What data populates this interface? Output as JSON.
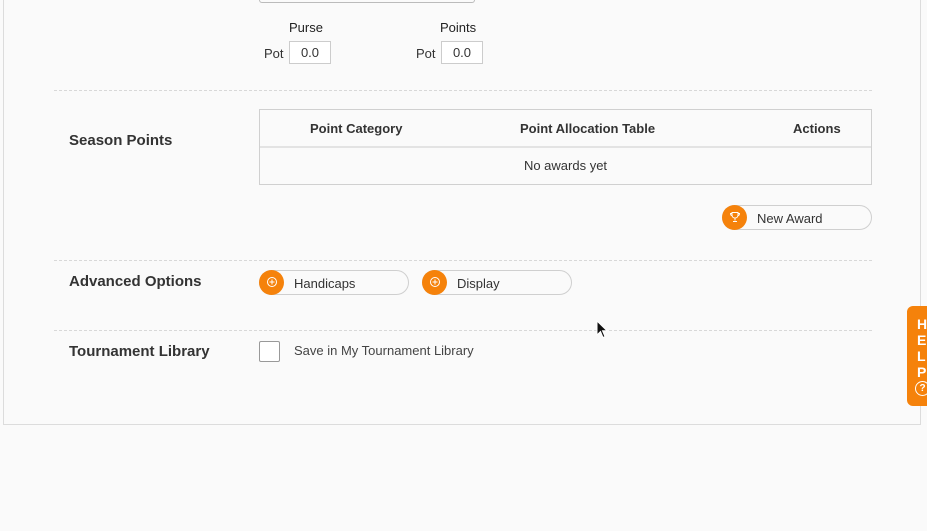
{
  "pots": {
    "purse": {
      "heading": "Purse",
      "label": "Pot",
      "value": "0.0"
    },
    "points": {
      "heading": "Points",
      "label": "Pot",
      "value": "0.0"
    }
  },
  "season_points": {
    "label": "Season Points",
    "columns": [
      "Point Category",
      "Point Allocation Table",
      "Actions"
    ],
    "empty_message": "No awards yet",
    "new_award_label": "New Award",
    "new_award_icon": "trophy-icon"
  },
  "advanced_options": {
    "label": "Advanced Options",
    "buttons": [
      {
        "label": "Handicaps",
        "icon": "plus-icon"
      },
      {
        "label": "Display",
        "icon": "plus-icon"
      }
    ]
  },
  "tournament_library": {
    "label": "Tournament Library",
    "checkbox_label": "Save in My Tournament Library",
    "checked": false
  },
  "help_tab": {
    "letters": [
      "H",
      "E",
      "L",
      "P"
    ],
    "icon": "question-icon"
  },
  "colors": {
    "accent": "#f5820b"
  }
}
